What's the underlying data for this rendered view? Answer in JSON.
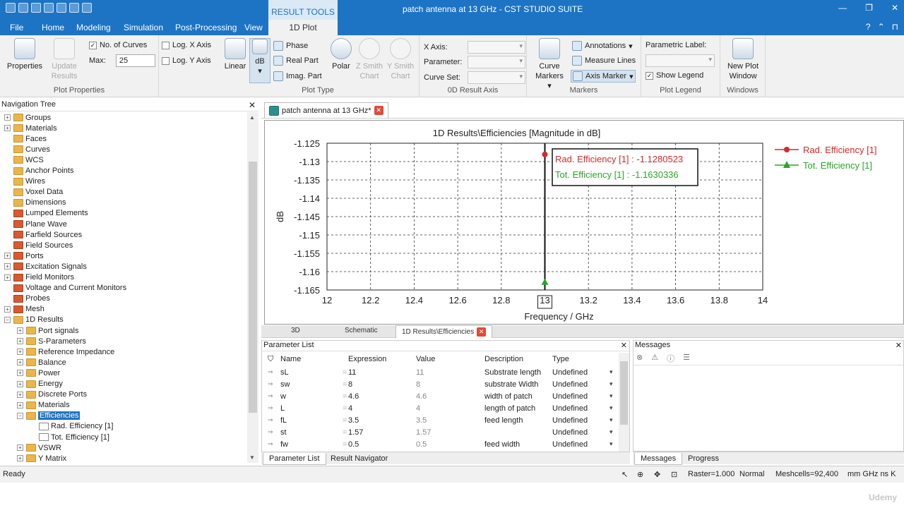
{
  "titlebar": {
    "title": "patch antenna at 13 GHz - CST STUDIO SUITE",
    "context_group": "RESULT TOOLS"
  },
  "menu": {
    "file": "File",
    "tabs": [
      "Home",
      "Modeling",
      "Simulation",
      "Post-Processing",
      "View"
    ],
    "active_tab": "1D Plot"
  },
  "ribbon": {
    "plot_properties": {
      "properties": "Properties",
      "update": "Update",
      "results": "Results",
      "no_curves": "No. of Curves",
      "max_label": "Max:",
      "max_value": "25",
      "log_x": "Log. X Axis",
      "log_y": "Log. Y Axis",
      "group": "Plot Properties"
    },
    "plot_type": {
      "linear": "Linear",
      "db": "dB",
      "phase": "Phase",
      "real": "Real Part",
      "imag": "Imag. Part",
      "polar": "Polar",
      "z_smith_1": "Z Smith",
      "z_smith_2": "Chart",
      "y_smith_1": "Y Smith",
      "y_smith_2": "Chart",
      "group": "Plot Type"
    },
    "axis0d": {
      "x_axis": "X Axis:",
      "parameter": "Parameter:",
      "curve_set": "Curve Set:",
      "group": "0D Result Axis"
    },
    "markers": {
      "curve": "Curve",
      "curve2": "Markers",
      "annotations": "Annotations",
      "measure": "Measure Lines",
      "axis_marker": "Axis Marker",
      "group": "Markers"
    },
    "legend": {
      "param_label": "Parametric Label:",
      "show": "Show Legend",
      "group": "Plot Legend"
    },
    "windows": {
      "new1": "New Plot",
      "new2": "Window",
      "group": "Windows"
    }
  },
  "nav": {
    "title": "Navigation Tree",
    "items": [
      {
        "label": "Groups",
        "level": 0,
        "exp": "+",
        "icon": "folder"
      },
      {
        "label": "Materials",
        "level": 0,
        "exp": "+",
        "icon": "folder"
      },
      {
        "label": "Faces",
        "level": 0,
        "exp": "",
        "icon": "folder"
      },
      {
        "label": "Curves",
        "level": 0,
        "exp": "",
        "icon": "folder"
      },
      {
        "label": "WCS",
        "level": 0,
        "exp": "",
        "icon": "folder"
      },
      {
        "label": "Anchor Points",
        "level": 0,
        "exp": "",
        "icon": "folder"
      },
      {
        "label": "Wires",
        "level": 0,
        "exp": "",
        "icon": "folder"
      },
      {
        "label": "Voxel Data",
        "level": 0,
        "exp": "",
        "icon": "folder"
      },
      {
        "label": "Dimensions",
        "level": 0,
        "exp": "",
        "icon": "folder"
      },
      {
        "label": "Lumped Elements",
        "level": 0,
        "exp": "",
        "icon": "folder-red"
      },
      {
        "label": "Plane Wave",
        "level": 0,
        "exp": "",
        "icon": "folder-red"
      },
      {
        "label": "Farfield Sources",
        "level": 0,
        "exp": "",
        "icon": "folder-red"
      },
      {
        "label": "Field Sources",
        "level": 0,
        "exp": "",
        "icon": "folder-red"
      },
      {
        "label": "Ports",
        "level": 0,
        "exp": "+",
        "icon": "folder-red"
      },
      {
        "label": "Excitation Signals",
        "level": 0,
        "exp": "+",
        "icon": "folder-red"
      },
      {
        "label": "Field Monitors",
        "level": 0,
        "exp": "+",
        "icon": "folder-red"
      },
      {
        "label": "Voltage and Current Monitors",
        "level": 0,
        "exp": "",
        "icon": "folder-red"
      },
      {
        "label": "Probes",
        "level": 0,
        "exp": "",
        "icon": "folder-red"
      },
      {
        "label": "Mesh",
        "level": 0,
        "exp": "+",
        "icon": "folder-red"
      },
      {
        "label": "1D Results",
        "level": 0,
        "exp": "−",
        "icon": "folder"
      },
      {
        "label": "Port signals",
        "level": 1,
        "exp": "+",
        "icon": "folder"
      },
      {
        "label": "S-Parameters",
        "level": 1,
        "exp": "+",
        "icon": "folder"
      },
      {
        "label": "Reference Impedance",
        "level": 1,
        "exp": "+",
        "icon": "folder"
      },
      {
        "label": "Balance",
        "level": 1,
        "exp": "+",
        "icon": "folder"
      },
      {
        "label": "Power",
        "level": 1,
        "exp": "+",
        "icon": "folder"
      },
      {
        "label": "Energy",
        "level": 1,
        "exp": "+",
        "icon": "folder"
      },
      {
        "label": "Discrete Ports",
        "level": 1,
        "exp": "+",
        "icon": "folder"
      },
      {
        "label": "Materials",
        "level": 1,
        "exp": "+",
        "icon": "folder"
      },
      {
        "label": "Efficiencies",
        "level": 1,
        "exp": "−",
        "icon": "folder",
        "selected": true
      },
      {
        "label": "Rad. Efficiency [1]",
        "level": 2,
        "exp": "",
        "icon": "curve"
      },
      {
        "label": "Tot. Efficiency [1]",
        "level": 2,
        "exp": "",
        "icon": "curve"
      },
      {
        "label": "VSWR",
        "level": 1,
        "exp": "+",
        "icon": "folder"
      },
      {
        "label": "Y Matrix",
        "level": 1,
        "exp": "+",
        "icon": "folder"
      }
    ]
  },
  "doc": {
    "tab": "patch antenna at 13 GHz*"
  },
  "chart_data": {
    "type": "line",
    "title": "1D Results\\Efficiencies [Magnitude in dB]",
    "xlabel": "Frequency / GHz",
    "ylabel": "dB",
    "xlim": [
      12,
      14
    ],
    "ylim": [
      -1.165,
      -1.125
    ],
    "xticks": [
      "12",
      "12.2",
      "12.4",
      "12.6",
      "12.8",
      "13",
      "13.2",
      "13.4",
      "13.6",
      "13.8",
      "14"
    ],
    "yticks": [
      "-1.125",
      "-1.13",
      "-1.135",
      "-1.14",
      "-1.145",
      "-1.15",
      "-1.155",
      "-1.16",
      "-1.165"
    ],
    "grid": true,
    "legend_position": "right",
    "axis_marker_x": 13,
    "series": [
      {
        "name": "Rad. Efficiency [1]",
        "color": "#d42a2a",
        "marker": "circle",
        "x": [
          13
        ],
        "y": [
          -1.1280523
        ]
      },
      {
        "name": "Tot. Efficiency [1]",
        "color": "#2aa52a",
        "marker": "triangle",
        "x": [
          13
        ],
        "y": [
          -1.1630336
        ]
      }
    ],
    "annotation": [
      "Rad. Efficiency [1] : -1.1280523",
      "Tot. Efficiency [1] : -1.1630336"
    ]
  },
  "bottom_tabs": {
    "t3d": "3D",
    "schematic": "Schematic",
    "results": "1D Results\\Efficiencies"
  },
  "params": {
    "title": "Parameter List",
    "headers": {
      "name": "Name",
      "expression": "Expression",
      "value": "Value",
      "description": "Description",
      "type": "Type"
    },
    "rows": [
      {
        "name": "sL",
        "expr": "11",
        "value": "11",
        "desc": "Substrate length",
        "type": "Undefined"
      },
      {
        "name": "sw",
        "expr": "8",
        "value": "8",
        "desc": "substrate Width",
        "type": "Undefined"
      },
      {
        "name": "w",
        "expr": "4.6",
        "value": "4.6",
        "desc": "width of patch",
        "type": "Undefined"
      },
      {
        "name": "L",
        "expr": "4",
        "value": "4",
        "desc": "length of patch",
        "type": "Undefined"
      },
      {
        "name": "fL",
        "expr": "3.5",
        "value": "3.5",
        "desc": "feed length",
        "type": "Undefined"
      },
      {
        "name": "st",
        "expr": "1.57",
        "value": "1.57",
        "desc": "",
        "type": "Undefined"
      },
      {
        "name": "fw",
        "expr": "0.5",
        "value": "0.5",
        "desc": "feed width",
        "type": "Undefined"
      }
    ],
    "tab_list": "Parameter List",
    "tab_nav": "Result Navigator"
  },
  "messages": {
    "title": "Messages",
    "tab_messages": "Messages",
    "tab_progress": "Progress"
  },
  "status": {
    "ready": "Ready",
    "raster": "Raster=1.000",
    "normal": "Normal",
    "meshcells": "Meshcells=92,400",
    "units": "mm  GHz  ns  K"
  },
  "watermark": "Udemy"
}
